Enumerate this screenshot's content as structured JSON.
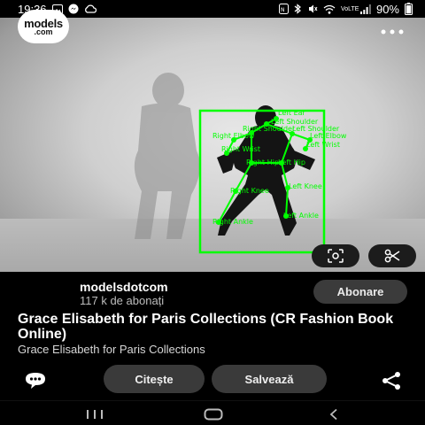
{
  "status_bar": {
    "time": "19:36",
    "battery": "90%",
    "icons": [
      "image-icon",
      "messenger-icon",
      "cloud-icon",
      "nfc-icon",
      "bluetooth-icon",
      "mute-icon",
      "wifi-icon",
      "signal-icon",
      "battery-icon"
    ],
    "network_label": "VoLTE"
  },
  "viewer": {
    "back_icon": "back-arrow-icon",
    "more_icon": "more-options-icon",
    "lens_icon": "lens-scan-icon",
    "cut_icon": "scissors-icon",
    "pose_color": "#00ff00",
    "keypoint_labels": {
      "left_ear": "Left Ear",
      "left_shoulder_top": "Left Shoulder",
      "right_shoulder": "Right Shoulder",
      "left_shoulder": "Left Shoulder",
      "right_elbow": "Right Elbow",
      "left_elbow": "Left Elbow",
      "right_wrist": "Right Wrist",
      "left_wrist": "Left Wrist",
      "right_hip": "Right Hip",
      "left_hip": "Left Hip",
      "right_knee": "Right Knee",
      "left_knee": "Left Knee",
      "right_ankle": "Right Ankle",
      "left_ankle": "Left Ankle"
    }
  },
  "channel": {
    "avatar_line1": "models",
    "avatar_line2": ".com",
    "name": "modelsdotcom",
    "subscribers": "117 k de abonați",
    "subscribe_label": "Abonare"
  },
  "pin": {
    "title": "Grace Elisabeth for Paris Collections (CR Fashion Book Online)",
    "subtitle": "Grace Elisabeth for Paris Collections"
  },
  "actions": {
    "comment_icon": "comment-icon",
    "read_label": "Citește",
    "save_label": "Salvează",
    "share_icon": "share-icon"
  },
  "nav": {
    "recents_icon": "recents-icon",
    "home_icon": "home-icon",
    "back_icon": "nav-back-icon"
  }
}
